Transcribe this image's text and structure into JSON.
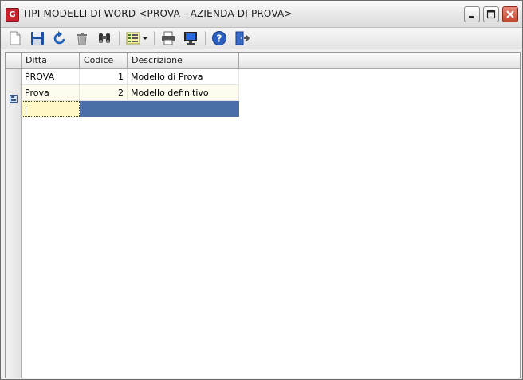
{
  "window": {
    "title": "TIPI MODELLI DI WORD <PROVA - AZIENDA DI PROVA>",
    "app_icon_letter": "G"
  },
  "toolbar": {
    "buttons": [
      {
        "name": "new-document-button",
        "icon": "document-icon"
      },
      {
        "name": "save-button",
        "icon": "floppy-icon"
      },
      {
        "name": "undo-button",
        "icon": "undo-icon"
      },
      {
        "name": "delete-button",
        "icon": "trash-icon"
      },
      {
        "name": "search-button",
        "icon": "binoculars-icon"
      },
      {
        "name": "view-options-button",
        "icon": "list-dropdown-icon"
      },
      {
        "name": "print-button",
        "icon": "printer-icon"
      },
      {
        "name": "preview-button",
        "icon": "monitor-icon"
      },
      {
        "name": "help-button",
        "icon": "help-icon"
      },
      {
        "name": "exit-button",
        "icon": "exit-door-icon"
      }
    ]
  },
  "grid": {
    "columns": [
      "Ditta",
      "Codice",
      "Descrizione"
    ],
    "rows": [
      {
        "ditta": "PROVA",
        "codice": "1",
        "descrizione": "Modello di Prova"
      },
      {
        "ditta": "Prova",
        "codice": "2",
        "descrizione": "Modello definitivo"
      }
    ]
  },
  "colors": {
    "new_row_highlight": "#4a6ea8",
    "alt_row": "#fcfbee",
    "close_button": "#c2452f"
  }
}
